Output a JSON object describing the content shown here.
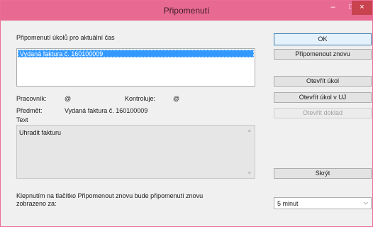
{
  "window": {
    "title": "Připomenutí",
    "controls": {
      "minimize": "–",
      "maximize": "□",
      "close": "×"
    }
  },
  "list": {
    "label": "Připomenutí úkolů pro aktuální čas",
    "items": [
      "Vydaná faktura č. 160100009"
    ]
  },
  "details": {
    "worker_label": "Pracovník:",
    "worker_value": "@",
    "reviewer_label": "Kontroluje:",
    "reviewer_value": "@",
    "subject_label": "Předmět:",
    "subject_value": "Vydaná faktura č. 160100009",
    "text_label": "Text",
    "text_value": "Uhradit fakturu"
  },
  "buttons": {
    "ok": "OK",
    "remind_again": "Připomenout znovu",
    "open_task": "Otevřít úkol",
    "open_task_uj": "Otevřít úkol v UJ",
    "open_document": "Otevřít doklad",
    "hide": "Skrýt"
  },
  "footer": {
    "text": "Klepnutím na tlačítko Připomenout znovu bude připomenutí znovu zobrazeno za:",
    "interval_selected": "5 minut"
  },
  "colors": {
    "titlebar": "#e86a93",
    "selection": "#3399ff",
    "close_button": "#c8434e"
  }
}
